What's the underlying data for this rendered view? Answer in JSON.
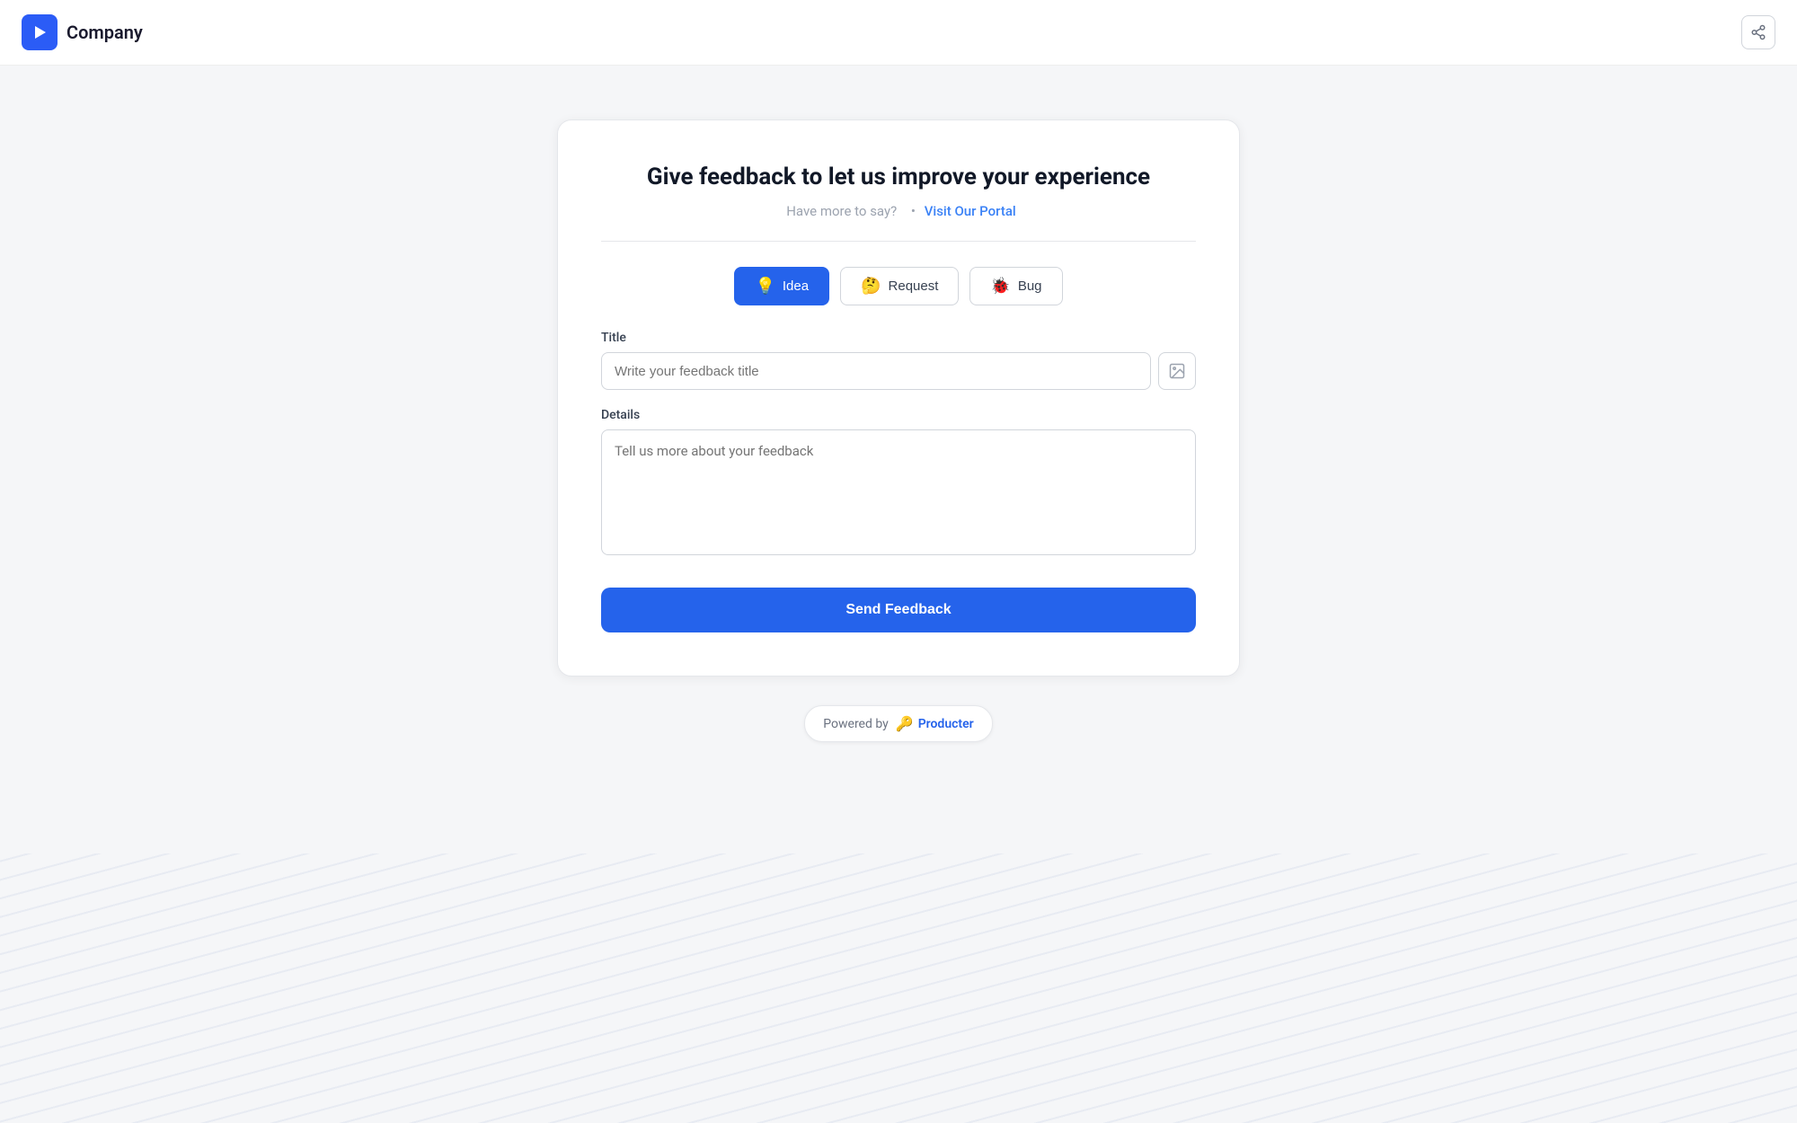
{
  "header": {
    "company_name": "Company",
    "logo_symbol": "◀",
    "share_label": "share"
  },
  "card": {
    "title": "Give feedback to let us improve your experience",
    "subtitle_text": "Have more to say?",
    "subtitle_separator": "•",
    "portal_link_text": "Visit Our Portal",
    "portal_link_url": "#"
  },
  "feedback_types": [
    {
      "id": "idea",
      "emoji": "💡",
      "label": "Idea",
      "active": true
    },
    {
      "id": "request",
      "emoji": "🤔",
      "label": "Request",
      "active": false
    },
    {
      "id": "bug",
      "emoji": "🐞",
      "label": "Bug",
      "active": false
    }
  ],
  "form": {
    "title_label": "Title",
    "title_placeholder": "Write your feedback title",
    "details_label": "Details",
    "details_placeholder": "Tell us more about your feedback",
    "submit_label": "Send Feedback"
  },
  "footer": {
    "powered_by_text": "Powered by",
    "brand_name": "Producter",
    "brand_icon": "🔑"
  }
}
